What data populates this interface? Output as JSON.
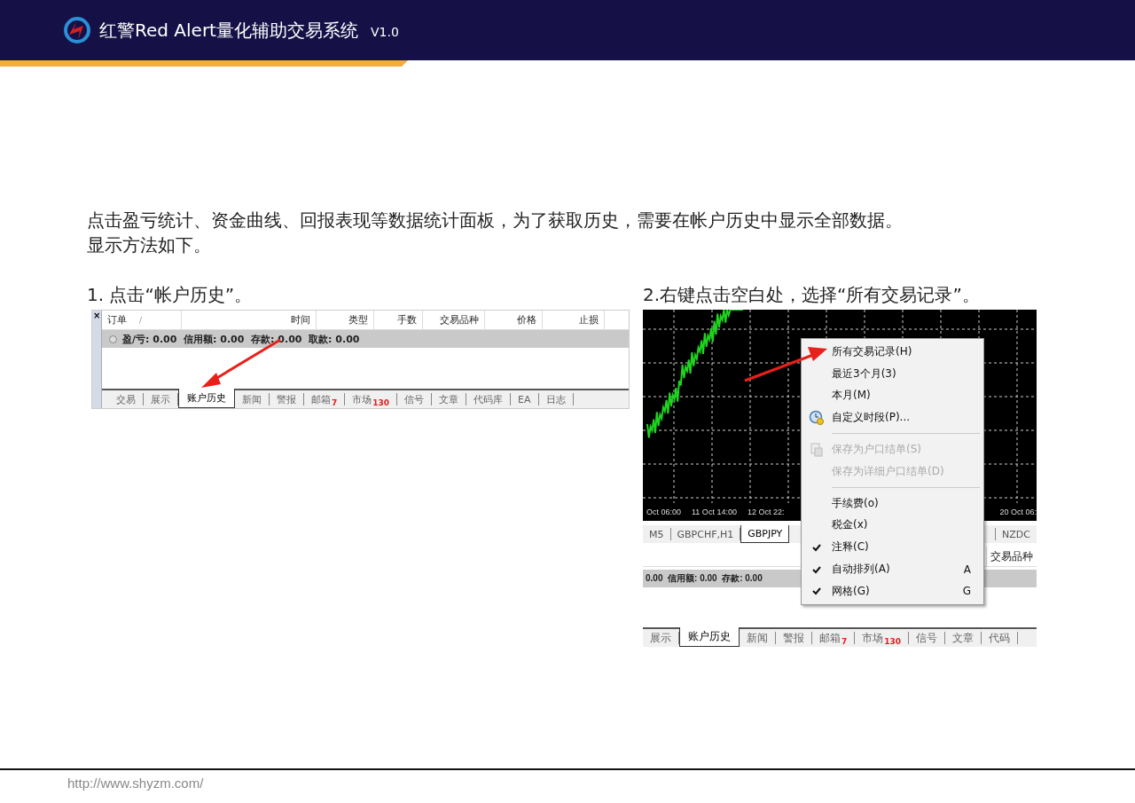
{
  "header": {
    "title": "红警Red Alert量化辅助交易系统",
    "version": "V1.0"
  },
  "intro": [
    "点击盈亏统计、资金曲线、回报表现等数据统计面板，为了获取历史，需要在帐户历史中显示全部数据。",
    "显示方法如下。"
  ],
  "step1": {
    "caption": "1. 点击“帐户历史”。",
    "close": "×",
    "columns": [
      {
        "label": "订单",
        "sort": "/"
      },
      {
        "label": "时间"
      },
      {
        "label": "类型"
      },
      {
        "label": "手数"
      },
      {
        "label": "交易品种"
      },
      {
        "label": "价格"
      },
      {
        "label": "止损"
      }
    ],
    "summary": "盈/亏: 0.00  信用额: 0.00  存款: 0.00  取款: 0.00",
    "tabs": [
      {
        "label": "交易",
        "selected": false
      },
      {
        "label": "展示",
        "selected": false
      },
      {
        "label": "账户历史",
        "selected": true
      },
      {
        "label": "新闻",
        "selected": false
      },
      {
        "label": "警报",
        "selected": false
      },
      {
        "label": "邮箱",
        "badge": "7",
        "selected": false
      },
      {
        "label": "市场",
        "badge": "130",
        "selected": false
      },
      {
        "label": "信号",
        "selected": false
      },
      {
        "label": "文章",
        "selected": false
      },
      {
        "label": "代码库",
        "selected": false
      },
      {
        "label": "EA",
        "selected": false
      },
      {
        "label": "日志",
        "selected": false
      }
    ]
  },
  "step2": {
    "caption": "2.右键点击空白处，选择“所有交易记录”。",
    "time_labels": [
      "Oct 06:00",
      "11 Oct 14:00",
      "12 Oct 22:",
      "20 Oct 06:"
    ],
    "symbol_tabs": [
      {
        "label": "M5",
        "selected": false
      },
      {
        "label": "GBPCHF,H1",
        "selected": false
      },
      {
        "label": "GBPJPY",
        "selected": true
      },
      {
        "label": "NZDC",
        "selected": false
      }
    ],
    "column": "交易品种",
    "summary": "0.00  信用额: 0.00  存款: 0.00",
    "tabs": [
      {
        "label": "展示",
        "selected": false
      },
      {
        "label": "账户历史",
        "selected": true
      },
      {
        "label": "新闻",
        "selected": false
      },
      {
        "label": "警报",
        "selected": false
      },
      {
        "label": "邮箱",
        "badge": "7",
        "selected": false
      },
      {
        "label": "市场",
        "badge": "130",
        "selected": false
      },
      {
        "label": "信号",
        "selected": false
      },
      {
        "label": "文章",
        "selected": false
      },
      {
        "label": "代码",
        "selected": false
      }
    ],
    "menu": [
      {
        "kind": "item",
        "label": "所有交易记录(H)",
        "checked": false,
        "disabled": false
      },
      {
        "kind": "item",
        "label": "最近3个月(3)",
        "checked": false,
        "disabled": false
      },
      {
        "kind": "item",
        "label": "本月(M)",
        "checked": false,
        "disabled": false
      },
      {
        "kind": "item",
        "label": "自定义时段(P)...",
        "icon": true,
        "checked": false,
        "disabled": false
      },
      {
        "kind": "separator"
      },
      {
        "kind": "item",
        "label": "保存为户口结单(S)",
        "icon": true,
        "checked": false,
        "disabled": true
      },
      {
        "kind": "item",
        "label": "保存为详细户口结单(D)",
        "checked": false,
        "disabled": true
      },
      {
        "kind": "separator"
      },
      {
        "kind": "item",
        "label": "手续费(o)",
        "checked": false,
        "disabled": false
      },
      {
        "kind": "item",
        "label": "税金(x)",
        "checked": false,
        "disabled": false
      },
      {
        "kind": "item",
        "label": "注释(C)",
        "checked": true,
        "disabled": false
      },
      {
        "kind": "item",
        "label": "自动排列(A)",
        "shortcut": "A",
        "checked": true,
        "disabled": false
      },
      {
        "kind": "item",
        "label": "网格(G)",
        "shortcut": "G",
        "checked": true,
        "disabled": false
      }
    ]
  },
  "footer": {
    "url": "http://www.shyzm.com/"
  }
}
